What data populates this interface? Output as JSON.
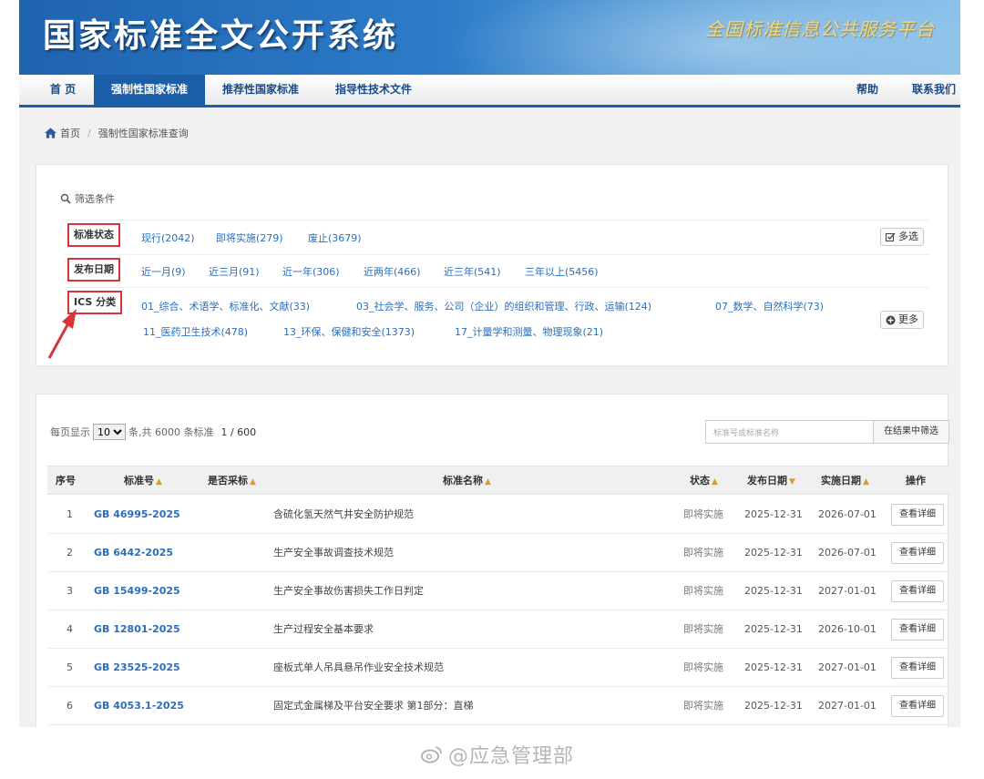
{
  "banner": {
    "title": "国家标准全文公开系统",
    "slogan": "全国标准信息公共服务平台"
  },
  "nav": {
    "items": [
      "首 页",
      "强制性国家标准",
      "推荐性国家标准",
      "指导性技术文件"
    ],
    "active_index": 1,
    "help": "帮助",
    "contact": "联系我们"
  },
  "breadcrumb": {
    "home": "首页",
    "separator": "/",
    "current": "强制性国家标准查询"
  },
  "filters": {
    "title": "筛选条件",
    "status": {
      "label": "标准状态",
      "options": [
        "现行(2042)",
        "即将实施(279)",
        "废止(3679)"
      ],
      "button": "多选"
    },
    "date": {
      "label": "发布日期",
      "options": [
        "近一月(9)",
        "近三月(91)",
        "近一年(306)",
        "近两年(466)",
        "近三年(541)",
        "三年以上(5456)"
      ]
    },
    "ics": {
      "label": "ICS 分类",
      "options_line1": [
        "01_综合、术语学、标准化、文献(33)",
        "03_社会学、服务、公司（企业）的组织和管理、行政、运输(124)",
        "07_数学、自然科学(73)"
      ],
      "options_line2": [
        "11_医药卫生技术(478)",
        "13_环保、保健和安全(1373)",
        "17_计量学和测量、物理现象(21)"
      ],
      "button": "更多"
    }
  },
  "results": {
    "per_page_label": "每页显示",
    "per_page_value": "10",
    "total_text": "条,共 6000 条标准",
    "page_text": "1 / 600",
    "search_placeholder": "标准号或标准名称",
    "search_button": "在结果中筛选",
    "columns": [
      "序号",
      "标准号",
      "是否采标",
      "标准名称",
      "状态",
      "发布日期",
      "实施日期",
      "操作"
    ],
    "rows": [
      {
        "no": "1",
        "code": "GB 46995-2025",
        "name": "含硫化氢天然气井安全防护规范",
        "status": "即将实施",
        "pub": "2025-12-31",
        "impl": "2026-07-01",
        "action": "查看详细"
      },
      {
        "no": "2",
        "code": "GB 6442-2025",
        "name": "生产安全事故调查技术规范",
        "status": "即将实施",
        "pub": "2025-12-31",
        "impl": "2026-07-01",
        "action": "查看详细"
      },
      {
        "no": "3",
        "code": "GB 15499-2025",
        "name": "生产安全事故伤害损失工作日判定",
        "status": "即将实施",
        "pub": "2025-12-31",
        "impl": "2027-01-01",
        "action": "查看详细"
      },
      {
        "no": "4",
        "code": "GB 12801-2025",
        "name": "生产过程安全基本要求",
        "status": "即将实施",
        "pub": "2025-12-31",
        "impl": "2026-10-01",
        "action": "查看详细"
      },
      {
        "no": "5",
        "code": "GB 23525-2025",
        "name": "座板式单人吊具悬吊作业安全技术规范",
        "status": "即将实施",
        "pub": "2025-12-31",
        "impl": "2027-01-01",
        "action": "查看详细"
      },
      {
        "no": "6",
        "code": "GB 4053.1-2025",
        "name": "固定式金属梯及平台安全要求 第1部分：直梯",
        "status": "即将实施",
        "pub": "2025-12-31",
        "impl": "2027-01-01",
        "action": "查看详细"
      }
    ]
  },
  "watermark": "@应急管理部",
  "colors": {
    "brand_blue": "#1a5ea8",
    "link_blue": "#2a6ebd",
    "highlight_red": "#d9343a",
    "sort_orange": "#e09a2b"
  }
}
